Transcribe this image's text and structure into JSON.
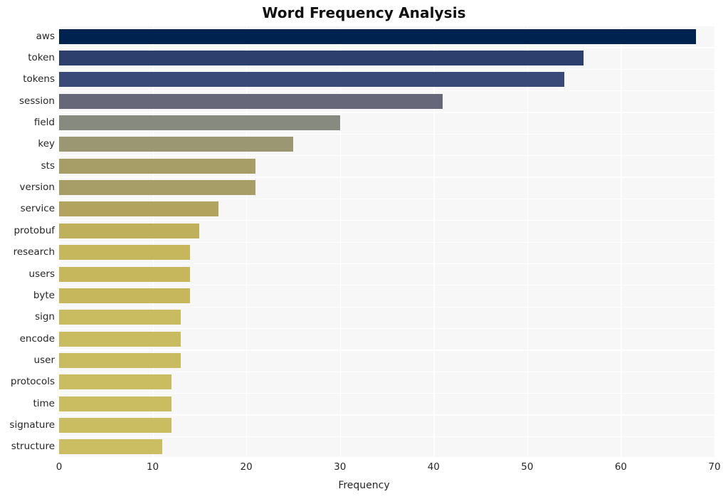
{
  "chart_data": {
    "type": "bar",
    "orientation": "horizontal",
    "title": "Word Frequency Analysis",
    "xlabel": "Frequency",
    "ylabel": "",
    "xlim": [
      0,
      70
    ],
    "xticks": [
      "0",
      "10",
      "20",
      "30",
      "40",
      "50",
      "60",
      "70"
    ],
    "xtick_values": [
      0,
      10,
      20,
      30,
      40,
      50,
      60,
      70
    ],
    "grid": true,
    "legend": "none",
    "categories": [
      "aws",
      "token",
      "tokens",
      "session",
      "field",
      "key",
      "sts",
      "version",
      "service",
      "protobuf",
      "research",
      "users",
      "byte",
      "sign",
      "encode",
      "user",
      "protocols",
      "time",
      "signature",
      "structure"
    ],
    "values": [
      68,
      56,
      54,
      41,
      30,
      25,
      21,
      21,
      17,
      15,
      14,
      14,
      14,
      13,
      13,
      13,
      12,
      12,
      12,
      11
    ],
    "bar_colors": [
      "#00224e",
      "#2d3f6c",
      "#3a4a78",
      "#66687a",
      "#878a7e",
      "#9a9772",
      "#a79d67",
      "#a79d67",
      "#b2a45f",
      "#bfb05b",
      "#c6b75d",
      "#c6b75d",
      "#c6b75d",
      "#c9bb5f",
      "#c9bb5f",
      "#c9bb5f",
      "#cabc60",
      "#cabc60",
      "#cabc60",
      "#cbbd61"
    ],
    "plot_background": "#f7f7f7",
    "grid_color": "#ffffff",
    "figure_background": "#ffffff",
    "text_color": "#262626"
  }
}
